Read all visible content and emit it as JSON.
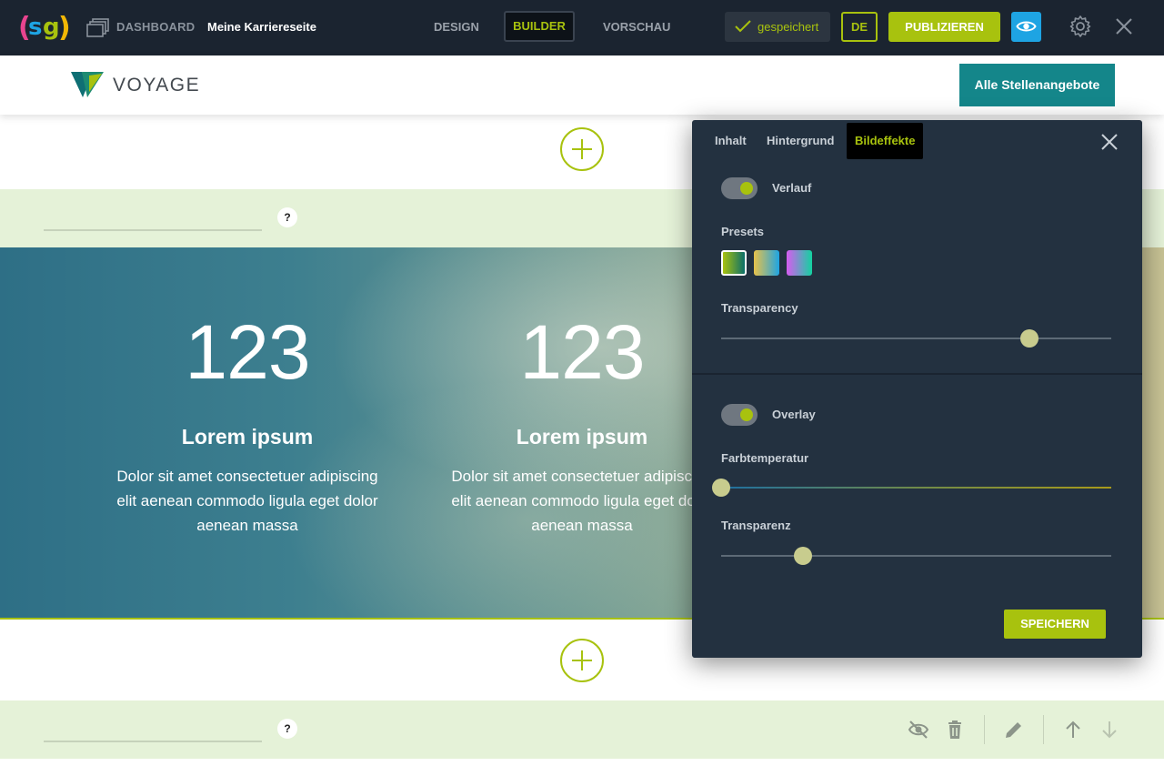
{
  "topbar": {
    "logo_text": "(sg)",
    "dashboard_label": "DASHBOARD",
    "site_name": "Meine Karriereseite",
    "nav": {
      "design": "DESIGN",
      "builder": "BUILDER",
      "preview": "VORSCHAU"
    },
    "saved_label": "gespeichert",
    "language": "DE",
    "publish_label": "PUBLIZIEREN"
  },
  "site": {
    "brand_name": "VOYAGE",
    "jobs_button": "Alle Stellenangebote"
  },
  "sections": {
    "help_label": "?"
  },
  "stats": [
    {
      "number": "123",
      "title": "Lorem ipsum",
      "text": "Dolor sit amet consectetuer adipiscing elit aenean commodo ligula eget dolor aenean massa"
    },
    {
      "number": "123",
      "title": "Lorem ipsum",
      "text": "Dolor sit amet consectetuer adipiscing elit aenean commodo ligula eget dolor aenean massa"
    }
  ],
  "panel": {
    "tabs": [
      "Inhalt",
      "Hintergrund",
      "Bildeffekte"
    ],
    "active_tab": "Bildeffekte",
    "gradient_label": "Verlauf",
    "gradient_enabled": true,
    "presets_label": "Presets",
    "presets_selected_index": 0,
    "transparency_label": "Transparency",
    "transparency_value": 0.79,
    "overlay_label": "Overlay",
    "overlay_enabled": true,
    "color_temp_label": "Farbtemperatur",
    "color_temp_value": 0.0,
    "transparenz_label": "Transparenz",
    "transparenz_value": 0.21,
    "save_label": "SPEICHERN"
  },
  "colors": {
    "accent": "#a8c20e",
    "topbar_bg": "#1b2430",
    "panel_bg": "#233140",
    "teal_button": "#14868a",
    "preview_blue": "#1ea4e3",
    "strip_bg": "#e5f2d8"
  }
}
